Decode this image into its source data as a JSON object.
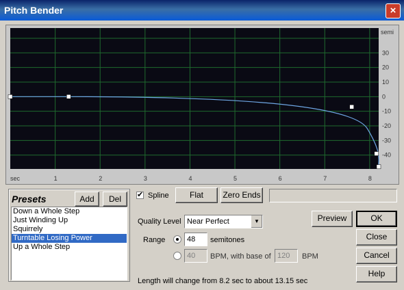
{
  "window": {
    "title": "Pitch Bender",
    "close_glyph": "×"
  },
  "graph": {
    "background": "#0a0a14",
    "grid_color": "#1f6a2e",
    "curve_color": "#6fa8e6",
    "y_unit": "semi",
    "x_unit": "sec",
    "y_ticks": [
      "30",
      "20",
      "10",
      "0",
      "-10",
      "-20",
      "-30",
      "-40"
    ],
    "x_ticks": [
      "1",
      "2",
      "3",
      "4",
      "5",
      "6",
      "7",
      "8"
    ],
    "points_sec_semi": [
      {
        "x": 0.0,
        "y": 0
      },
      {
        "x": 1.3,
        "y": 0
      },
      {
        "x": 7.6,
        "y": -7
      },
      {
        "x": 8.15,
        "y": -39
      },
      {
        "x": 8.2,
        "y": -48
      }
    ]
  },
  "presets": {
    "title": "Presets",
    "add_label": "Add",
    "del_label": "Del",
    "items": [
      {
        "label": "Down a Whole Step",
        "selected": false
      },
      {
        "label": "Just Winding Up",
        "selected": false
      },
      {
        "label": "Squirrely",
        "selected": false
      },
      {
        "label": "Turntable Losing Power",
        "selected": true
      },
      {
        "label": "Up a Whole Step",
        "selected": false
      }
    ]
  },
  "toolbar": {
    "spline_checked": true,
    "spline_label": "Spline",
    "flat_label": "Flat",
    "zero_ends_label": "Zero Ends"
  },
  "quality": {
    "label": "Quality Level",
    "value": "Near Perfect"
  },
  "range": {
    "label": "Range",
    "semitones_value": "48",
    "semitones_label": "semitones",
    "bpm_value": "40",
    "bpm_label": "BPM, with base of",
    "base_value": "120",
    "base_unit": "BPM"
  },
  "length_text": "Length will change from 8.2 sec to about 13.15 sec",
  "buttons": {
    "preview": "Preview",
    "ok": "OK",
    "close": "Close",
    "cancel": "Cancel",
    "help": "Help"
  }
}
